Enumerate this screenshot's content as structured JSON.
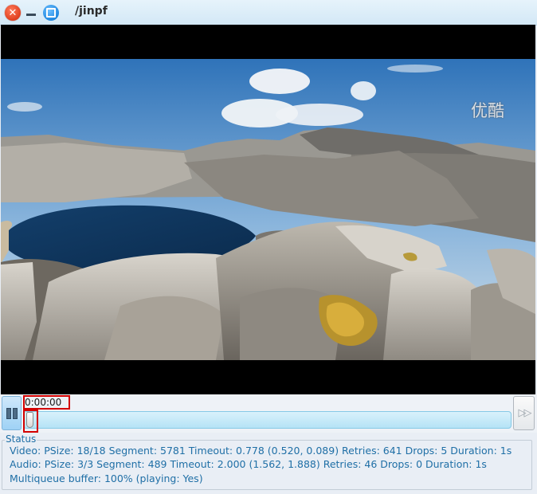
{
  "window": {
    "title": "/jinpf",
    "close_glyph": "✕"
  },
  "video": {
    "watermark": "优酷"
  },
  "controls": {
    "time": "0:00:00",
    "progress_fraction": 0.0,
    "step_glyph": "▷▷"
  },
  "status": {
    "title": "Status",
    "lines": [
      "Video: PSize: 18/18 Segment: 5781 Timeout: 0.778 (0.520, 0.089) Retries: 641 Drops: 5 Duration: 1s",
      "Audio: PSize: 3/3 Segment: 489 Timeout: 2.000 (1.562, 1.888) Retries: 46 Drops: 0 Duration: 1s",
      "Multiqueue buffer: 100% (playing: Yes)"
    ]
  },
  "icons": {
    "close": "close-icon",
    "minimize": "minimize-icon",
    "maximize": "maximize-icon",
    "pause": "pause-icon",
    "step": "step-forward-icon"
  },
  "colors": {
    "close": "#e0401f",
    "maximize": "#1f88e0",
    "status_text": "#1f6fa6",
    "highlight_box": "#d40000"
  }
}
